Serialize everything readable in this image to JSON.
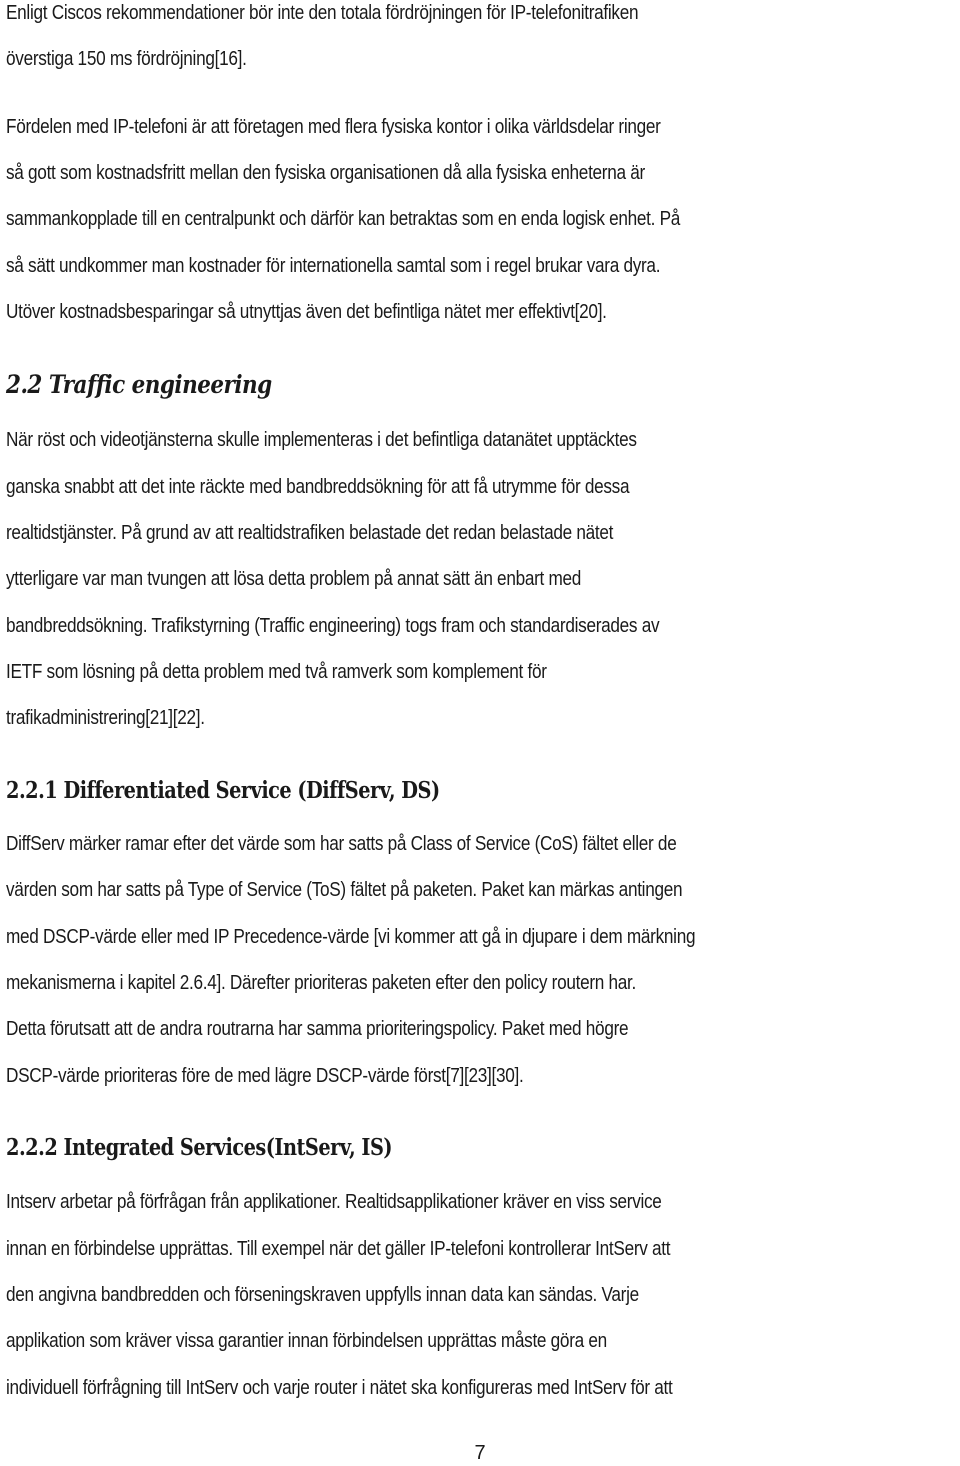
{
  "document": {
    "intro_paragraph_1": [
      "Enligt Ciscos rekommendationer bör inte den totala fördröjningen för IP-telefonitrafiken",
      "överstiga 150 ms fördröjning[16]."
    ],
    "intro_paragraph_2": [
      "Fördelen med IP-telefoni är att företagen med flera fysiska kontor i olika världsdelar ringer",
      "så gott som kostnadsfritt mellan den fysiska organisationen då alla fysiska enheterna är",
      "sammankopplade till en centralpunkt och därför kan betraktas som en enda logisk enhet. På",
      "så sätt undkommer man kostnader för internationella samtal som i regel brukar vara dyra.",
      "Utöver kostnadsbesparingar så utnyttjas även det befintliga nätet mer effektivt[20]."
    ],
    "section_2_2": {
      "heading": "2.2 Traffic engineering",
      "lines": [
        "När röst och videotjänsterna skulle implementeras i det befintliga datanätet upptäcktes",
        "ganska snabbt att det inte räckte med bandbreddsökning för att få utrymme för dessa",
        "realtidstjänster. På grund av att realtidstrafiken belastade det redan belastade nätet",
        "ytterligare var man tvungen att lösa detta problem på annat sätt än enbart med",
        "bandbreddsökning. Trafikstyrning (Traffic engineering) togs fram och standardiserades av",
        "IETF som lösning på detta problem med två ramverk som komplement för",
        "trafikadministrering[21][22]."
      ]
    },
    "section_2_2_1": {
      "heading": "2.2.1 Differentiated Service (DiffServ, DS)",
      "lines": [
        "DiffServ märker ramar efter det värde som har satts på Class of Service (CoS) fältet eller de",
        "värden som har satts på Type of Service (ToS) fältet på paketen. Paket kan märkas antingen",
        "med DSCP-värde eller med IP Precedence-värde [vi kommer att gå in djupare i dem märkning",
        "mekanismerna i kapitel 2.6.4]. Därefter prioriteras paketen efter den policy routern har.",
        "Detta förutsatt att de andra routrarna har samma prioriteringspolicy. Paket med högre",
        "DSCP-värde prioriteras före de med lägre DSCP-värde först[7][23][30]."
      ]
    },
    "section_2_2_2": {
      "heading": "2.2.2 Integrated Services(IntServ, IS)",
      "lines": [
        "Intserv arbetar på förfrågan från applikationer. Realtidsapplikationer kräver en viss service",
        "innan en förbindelse upprättas. Till exempel när det gäller IP-telefoni kontrollerar IntServ att",
        "den angivna bandbredden och förseningskraven uppfylls innan data kan sändas.  Varje",
        "applikation som kräver vissa garantier innan förbindelsen upprättas måste göra en",
        "individuell förfrågning till IntServ och varje router i nätet ska konfigureras med IntServ för att"
      ]
    },
    "page_number": "7"
  }
}
